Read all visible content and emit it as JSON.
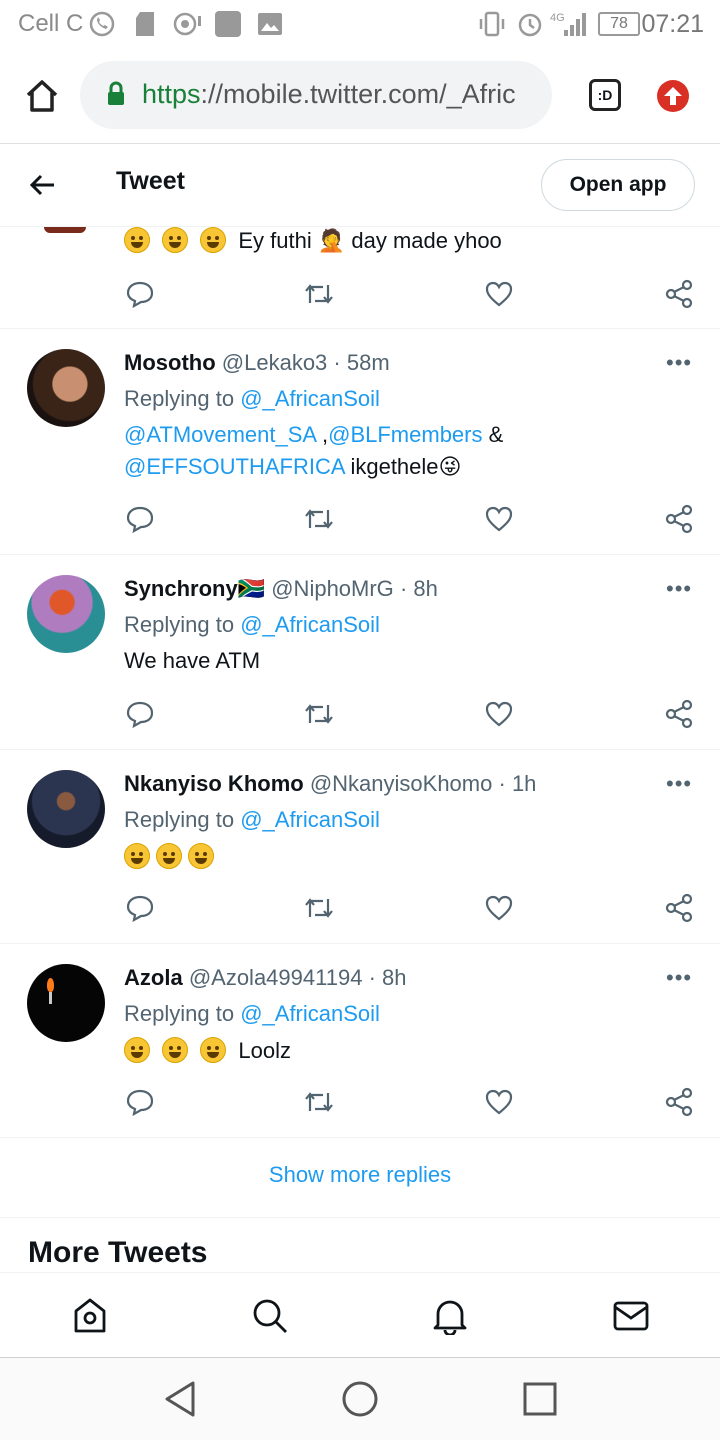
{
  "status_bar": {
    "carrier": "Cell C",
    "battery": "78",
    "network": "4G",
    "time": "07:21"
  },
  "browser": {
    "url_scheme": "https",
    "url_rest": "://mobile.twitter.com/_Afric",
    "tab_icon_label": ":D"
  },
  "header": {
    "title": "Tweet",
    "open_app_label": "Open app"
  },
  "top_partial_tweet": {
    "text": "Ey futhi 🤦 day made yhoo"
  },
  "replies": [
    {
      "name": "Mosotho",
      "handle": "@Lekako3",
      "time": "58m",
      "replying_prefix": "Replying to",
      "replying_to": "@_AfricanSoil",
      "mention_1": "@ATMovement_SA",
      "mention_sep": " ,",
      "mention_2": "@BLFmembers",
      "amp": " &",
      "mention_3": "@EFFSOUTHAFRICA",
      "text": " ikgethele😜"
    },
    {
      "name": "Synchrony🇿🇦",
      "handle": "@NiphoMrG",
      "time": "8h",
      "replying_prefix": "Replying to",
      "replying_to": "@_AfricanSoil",
      "text": "We have ATM"
    },
    {
      "name": "Nkanyiso Khomo",
      "handle": "@NkanyisoKhomo",
      "time": "1h",
      "replying_prefix": "Replying to",
      "replying_to": "@_AfricanSoil",
      "text": ""
    },
    {
      "name": "Azola",
      "handle": "@Azola49941194",
      "time": "8h",
      "replying_prefix": "Replying to",
      "replying_to": "@_AfricanSoil",
      "text": "Loolz"
    }
  ],
  "show_more_label": "Show more replies",
  "more_tweets_label": "More Tweets",
  "icons": {
    "reply": "reply-icon",
    "retweet": "retweet-icon",
    "like": "heart-icon",
    "share": "share-icon"
  },
  "colors": {
    "link": "#1d9bf0",
    "muted": "#536471",
    "text": "#0f1419"
  }
}
